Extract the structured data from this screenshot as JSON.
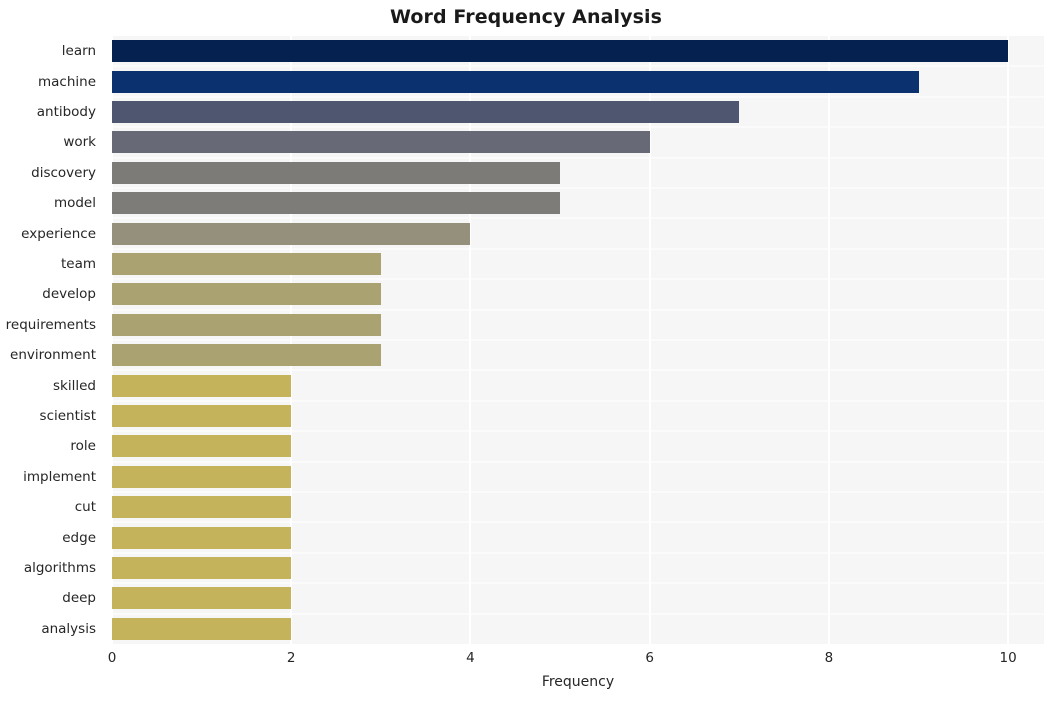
{
  "chart_data": {
    "type": "bar",
    "orientation": "horizontal",
    "title": "Word Frequency Analysis",
    "xlabel": "Frequency",
    "ylabel": "",
    "xlim": [
      0,
      10.4
    ],
    "ylim": [
      0,
      20
    ],
    "grid": true,
    "legend": null,
    "xticks": [
      "0",
      "2",
      "4",
      "6",
      "8",
      "10"
    ],
    "xtick_values": [
      0,
      2,
      4,
      6,
      8,
      10
    ],
    "categories": [
      "learn",
      "machine",
      "antibody",
      "work",
      "discovery",
      "model",
      "experience",
      "team",
      "develop",
      "requirements",
      "environment",
      "skilled",
      "scientist",
      "role",
      "implement",
      "cut",
      "edge",
      "algorithms",
      "deep",
      "analysis"
    ],
    "values": [
      10,
      9,
      7,
      6,
      5,
      5,
      4,
      3,
      3,
      3,
      3,
      2,
      2,
      2,
      2,
      2,
      2,
      2,
      2,
      2
    ],
    "bar_colors": [
      "#042150",
      "#0b316e",
      "#4f5670",
      "#676a76",
      "#7c7b78",
      "#7d7c79",
      "#94907c",
      "#aba272",
      "#aba272",
      "#aba272",
      "#aba272",
      "#c5b35c",
      "#c5b35c",
      "#c5b35c",
      "#c5b35c",
      "#c5b35c",
      "#c5b35c",
      "#c5b35c",
      "#c5b35c",
      "#c5b35c"
    ],
    "plot_background": "#f6f6f6",
    "grid_color": "#ffffff",
    "figure_background": "#ffffff"
  }
}
